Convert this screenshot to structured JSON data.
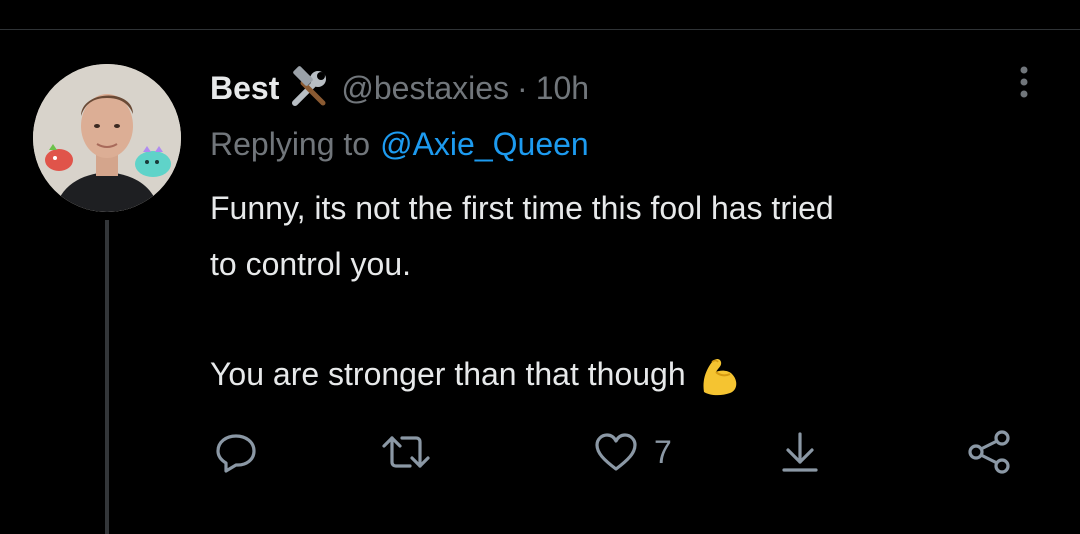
{
  "tweet": {
    "author_name": "Best",
    "author_handle": "@bestaxies",
    "separator": "·",
    "time": "10h",
    "replying_to_label": "Replying to",
    "replying_to_handle": "@Axie_Queen",
    "text_lines": [
      "Funny, its not the first time this fool has tried",
      "to control you.",
      "You are stronger than that though"
    ],
    "emoji": "flexed-biceps",
    "badge_icon": "hammer-and-wrench-icon"
  },
  "actions": {
    "like_count": "7",
    "icons": [
      "reply-icon",
      "retweet-icon",
      "like-icon",
      "bookmark-download-icon",
      "share-icon"
    ]
  },
  "colors": {
    "background": "#000000",
    "text": "#e7e9ea",
    "muted": "#71767b",
    "link": "#1d9bf0",
    "icon": "#8b98a5",
    "divider": "#2f3336"
  }
}
